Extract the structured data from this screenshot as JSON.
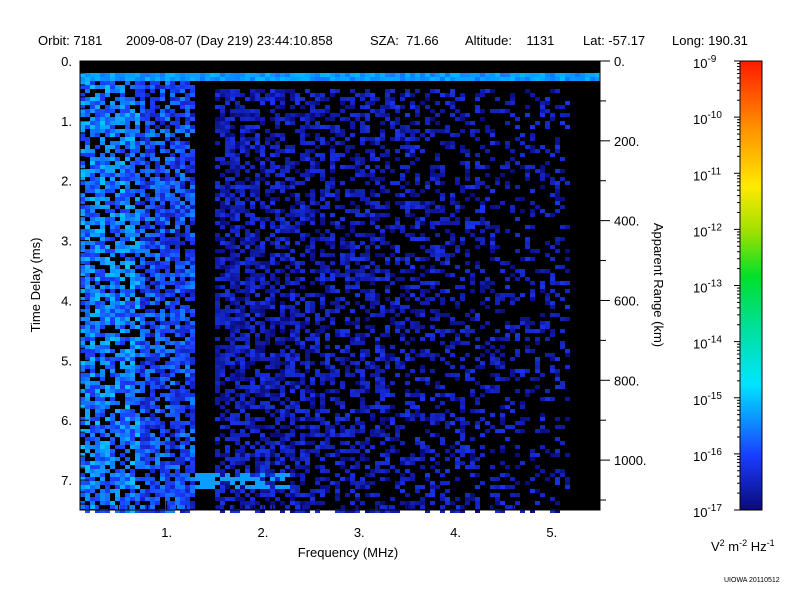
{
  "header": {
    "orbit": "Orbit: 7181",
    "time": "2009-08-07 (Day 219) 23:44:10.858",
    "sza": "SZA:  71.66",
    "altitude": "Altitude:    1131",
    "lat": "Lat: -57.17",
    "long": "Long: 190.31"
  },
  "credit": "UIOWA 20110512",
  "chart_data": {
    "type": "heatmap",
    "xlabel": "Frequency (MHz)",
    "ylabel": "Time Delay (ms)",
    "y2label": "Apparent Range (km)",
    "xlim": [
      0.1,
      5.5
    ],
    "ylim": [
      0,
      7.5
    ],
    "y2lim": [
      0,
      1125
    ],
    "x_ticks": [
      1,
      2,
      3,
      4,
      5
    ],
    "x_tick_labels": [
      "1.",
      "2.",
      "3.",
      "4.",
      "5."
    ],
    "y_ticks": [
      0,
      1,
      2,
      3,
      4,
      5,
      6,
      7
    ],
    "y_tick_labels": [
      "0.",
      "1.",
      "2.",
      "3.",
      "4.",
      "5.",
      "6.",
      "7."
    ],
    "y2_ticks": [
      0,
      200,
      400,
      600,
      800,
      1000
    ],
    "y2_tick_labels": [
      "0.",
      "200.",
      "400.",
      "600.",
      "800.",
      "1000."
    ],
    "colorbar": {
      "scale": "log",
      "range": [
        1e-17,
        1e-09
      ],
      "tick_exponents": [
        -9,
        -10,
        -11,
        -12,
        -13,
        -14,
        -15,
        -16,
        -17
      ],
      "tick_base": "10",
      "units": [
        "V",
        "2",
        " m",
        "-2",
        " Hz",
        "-1"
      ]
    },
    "features": [
      {
        "name": "surface/noise band",
        "delay_ms": 0.25,
        "freq_range_mhz": [
          0.1,
          5.5
        ],
        "log10_intensity": -15.6
      },
      {
        "name": "low-frequency emission",
        "freq_range_mhz": [
          0.1,
          1.3
        ],
        "delay_range_ms": [
          0.2,
          7.5
        ],
        "log10_intensity": -15.0
      },
      {
        "name": "ionospheric echo",
        "delay_ms": 7.0,
        "freq_range_mhz": [
          1.3,
          2.3
        ],
        "log10_intensity": -15.3
      },
      {
        "name": "scattered echoes",
        "freq_range_mhz": [
          1.5,
          5.2
        ],
        "delay_range_ms": [
          0.5,
          7.5
        ],
        "log10_intensity": -16.2
      }
    ]
  }
}
